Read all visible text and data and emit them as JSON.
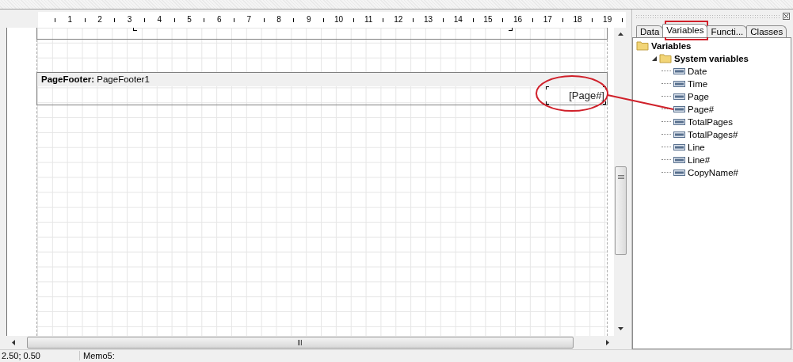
{
  "ruler": {
    "labels": [
      "1",
      "2",
      "3",
      "4",
      "5",
      "6",
      "7",
      "8",
      "9",
      "10",
      "11",
      "12",
      "13",
      "14",
      "15",
      "16",
      "17",
      "18",
      "19"
    ]
  },
  "page_footer": {
    "type_label": "PageFooter:",
    "name": "PageFooter1",
    "text_field": "[Page#]"
  },
  "panel": {
    "tabs": [
      {
        "label": "Data",
        "selected": false
      },
      {
        "label": "Variables",
        "selected": true
      },
      {
        "label": "Functi...",
        "selected": false
      },
      {
        "label": "Classes",
        "selected": false
      }
    ],
    "tree": [
      {
        "label": "Variables",
        "kind": "folder",
        "children": [
          {
            "label": "System variables",
            "kind": "folder",
            "expanded": true,
            "children": [
              {
                "label": "Date",
                "kind": "variable"
              },
              {
                "label": "Time",
                "kind": "variable"
              },
              {
                "label": "Page",
                "kind": "variable"
              },
              {
                "label": "Page#",
                "kind": "variable"
              },
              {
                "label": "TotalPages",
                "kind": "variable"
              },
              {
                "label": "TotalPages#",
                "kind": "variable"
              },
              {
                "label": "Line",
                "kind": "variable"
              },
              {
                "label": "Line#",
                "kind": "variable"
              },
              {
                "label": "CopyName#",
                "kind": "variable"
              }
            ]
          }
        ]
      }
    ]
  },
  "status_bar": [
    "2.50; 0.50",
    "Memo5:"
  ]
}
